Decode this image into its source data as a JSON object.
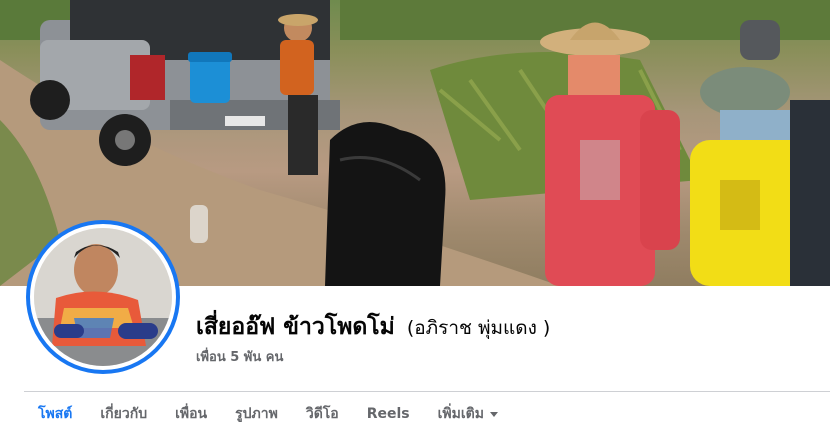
{
  "profile": {
    "name": "เสี่ยออ๊ฟ ข้าวโพดโม่",
    "alternate_name": "(อภิราช พุ่มแดง )",
    "friends_count": "เพื่อน 5 พัน คน"
  },
  "tabs": [
    {
      "label": "โพสต์",
      "active": true
    },
    {
      "label": "เกี่ยวกับ",
      "active": false
    },
    {
      "label": "เพื่อน",
      "active": false
    },
    {
      "label": "รูปภาพ",
      "active": false
    },
    {
      "label": "วิดีโอ",
      "active": false
    },
    {
      "label": "Reels",
      "active": false
    },
    {
      "label": "เพิ่มเติม",
      "active": false
    }
  ],
  "colors": {
    "accent": "#1877f2",
    "text_primary": "#050505",
    "text_secondary": "#65676b",
    "divider": "#ced0d4"
  },
  "icons": {
    "more_tab": "caret-down-icon"
  }
}
